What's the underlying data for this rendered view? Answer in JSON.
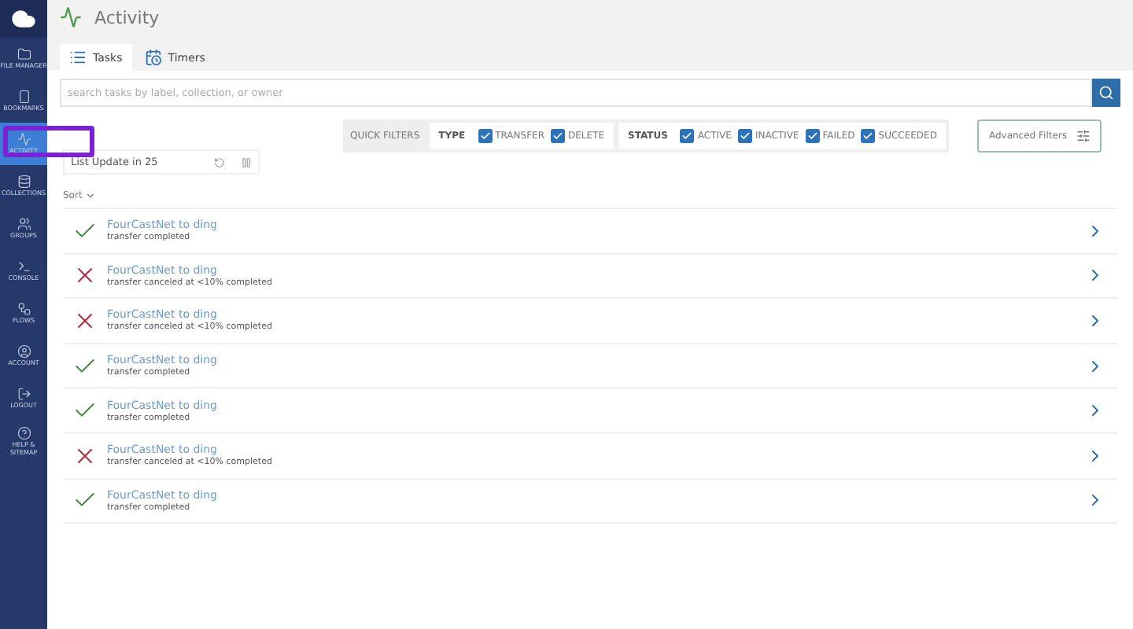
{
  "sidebar": {
    "items": [
      {
        "label": "FILE MANAGER",
        "selected": false
      },
      {
        "label": "BOOKMARKS",
        "selected": false
      },
      {
        "label": "ACTIVITY",
        "selected": true
      },
      {
        "label": "COLLECTIONS",
        "selected": false
      },
      {
        "label": "GROUPS",
        "selected": false
      },
      {
        "label": "CONSOLE",
        "selected": false
      },
      {
        "label": "FLOWS",
        "selected": false
      },
      {
        "label": "ACCOUNT",
        "selected": false
      },
      {
        "label": "LOGOUT",
        "selected": false
      },
      {
        "label": "HELP & SITEMAP",
        "selected": false
      }
    ]
  },
  "page": {
    "title": "Activity"
  },
  "tabs": [
    {
      "label": "Tasks",
      "selected": true
    },
    {
      "label": "Timers",
      "selected": false
    }
  ],
  "search": {
    "placeholder": "search tasks by label, collection, or owner"
  },
  "quick_filters": {
    "label": "QUICK FILTERS",
    "groups": [
      {
        "label": "TYPE",
        "options": [
          {
            "label": "TRANSFER",
            "checked": true
          },
          {
            "label": "DELETE",
            "checked": true
          }
        ]
      },
      {
        "label": "STATUS",
        "options": [
          {
            "label": "ACTIVE",
            "checked": true
          },
          {
            "label": "INACTIVE",
            "checked": true
          },
          {
            "label": "FAILED",
            "checked": true
          },
          {
            "label": "SUCCEEDED",
            "checked": true
          }
        ]
      }
    ]
  },
  "advanced_filters": "Advanced Filters",
  "list_update": "List Update in 25",
  "sort": "Sort",
  "tasks": [
    {
      "title": "FourCastNet to ding",
      "status": "transfer completed",
      "kind": "succeeded"
    },
    {
      "title": "FourCastNet to ding",
      "status": "transfer canceled at <10% completed",
      "kind": "failed"
    },
    {
      "title": "FourCastNet to ding",
      "status": "transfer canceled at <10% completed",
      "kind": "failed"
    },
    {
      "title": "FourCastNet to ding",
      "status": "transfer completed",
      "kind": "succeeded"
    },
    {
      "title": "FourCastNet to ding",
      "status": "transfer completed",
      "kind": "succeeded"
    },
    {
      "title": "FourCastNet to ding",
      "status": "transfer canceled at <10% completed",
      "kind": "failed"
    },
    {
      "title": "FourCastNet to ding",
      "status": "transfer completed",
      "kind": "succeeded"
    }
  ]
}
